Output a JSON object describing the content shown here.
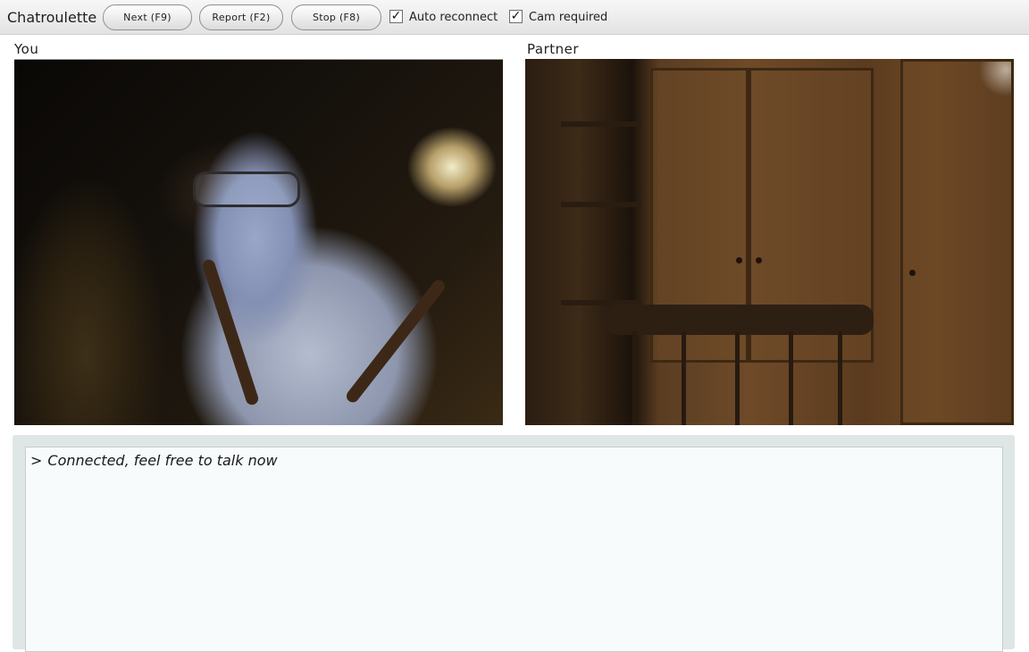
{
  "app": {
    "title": "Chatroulette"
  },
  "toolbar": {
    "next_label": "Next (F9)",
    "report_label": "Report (F2)",
    "stop_label": "Stop (F8)",
    "auto_reconnect": {
      "label": "Auto reconnect",
      "checked": true
    },
    "cam_required": {
      "label": "Cam required",
      "checked": true
    },
    "checkmark": "✓"
  },
  "panels": {
    "you_label": "You",
    "partner_label": "Partner"
  },
  "chat": {
    "prompt": ">",
    "messages": [
      {
        "text": "Connected, feel free to talk now"
      }
    ]
  },
  "colors": {
    "toolbar_bg": "#e9e9e9",
    "chat_frame": "#dfe6e6",
    "chat_bg": "#f7fbfb"
  },
  "icons": {
    "auto_reconnect": "checkbox-checked-icon",
    "cam_required": "checkbox-checked-icon"
  }
}
